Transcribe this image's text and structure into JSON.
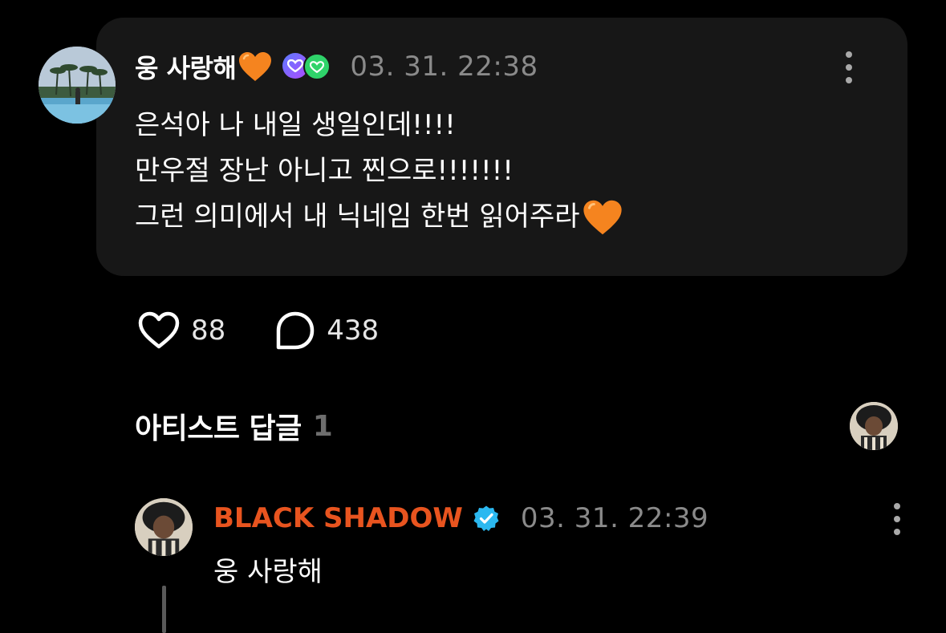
{
  "post": {
    "author": "웅 사랑해",
    "timestamp": "03. 31. 22:38",
    "lines": [
      "은석아 나 내일 생일인데!!!!",
      "만우절 장난 아니고 찐으로!!!!!!!",
      "그런 의미에서 내 닉네임 한번 읽어주라"
    ],
    "author_emoji": "orange-heart-icon",
    "membership_icons": [
      "membership-badge-purple-icon",
      "membership-badge-green-icon"
    ],
    "likes": "88",
    "comments": "438"
  },
  "artist_replies": {
    "label": "아티스트 답글",
    "count": "1"
  },
  "reply": {
    "author": "BLACK SHADOW",
    "timestamp": "03. 31. 22:39",
    "text": "웅 사랑해",
    "verified_icon": "verified-check-icon"
  },
  "colors": {
    "background": "#000000",
    "bubble": "#171717",
    "artist_name": "#e8541f",
    "timestamp": "#8a8a8a",
    "verified": "#2bb8f0"
  }
}
